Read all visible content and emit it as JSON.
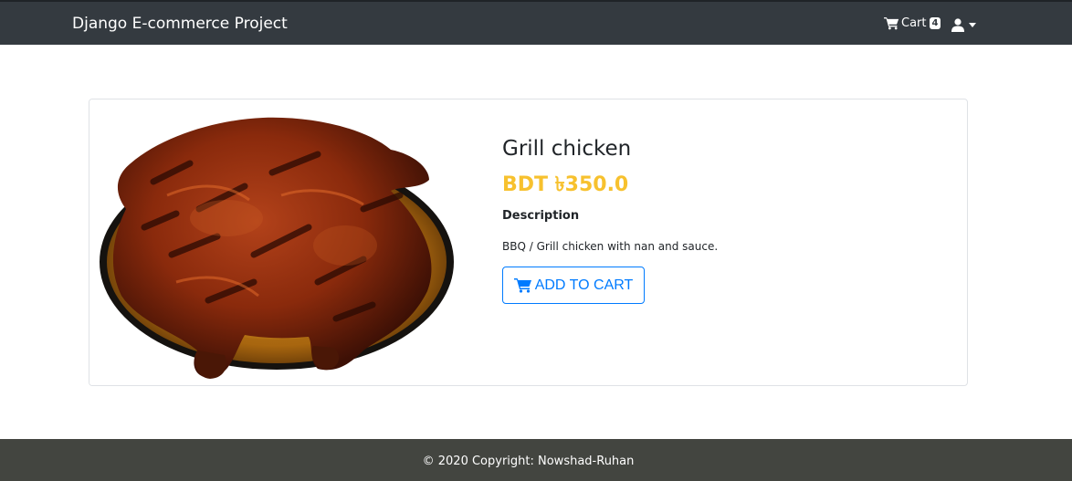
{
  "navbar": {
    "brand": "Django E-commerce Project",
    "cart_label": "Cart",
    "cart_count": "4",
    "cart_icon": "shopping-cart-icon",
    "user_icon": "user-icon",
    "user_caret_icon": "caret-down-icon"
  },
  "product": {
    "image_alt": "grilled chicken on a plate",
    "name": "Grill chicken",
    "price": "BDT ৳350.0",
    "description_heading": "Description",
    "description": "BBQ / Grill chicken with nan and sauce.",
    "add_to_cart_label": "ADD TO CART",
    "add_to_cart_icon": "shopping-cart-icon"
  },
  "footer": {
    "copyright": "© 2020 Copyright: Nowshad-Ruhan"
  },
  "colors": {
    "navbar_bg": "#343a40",
    "price": "#f7c12e",
    "primary": "#007bff",
    "footer_bg": "#434540"
  }
}
